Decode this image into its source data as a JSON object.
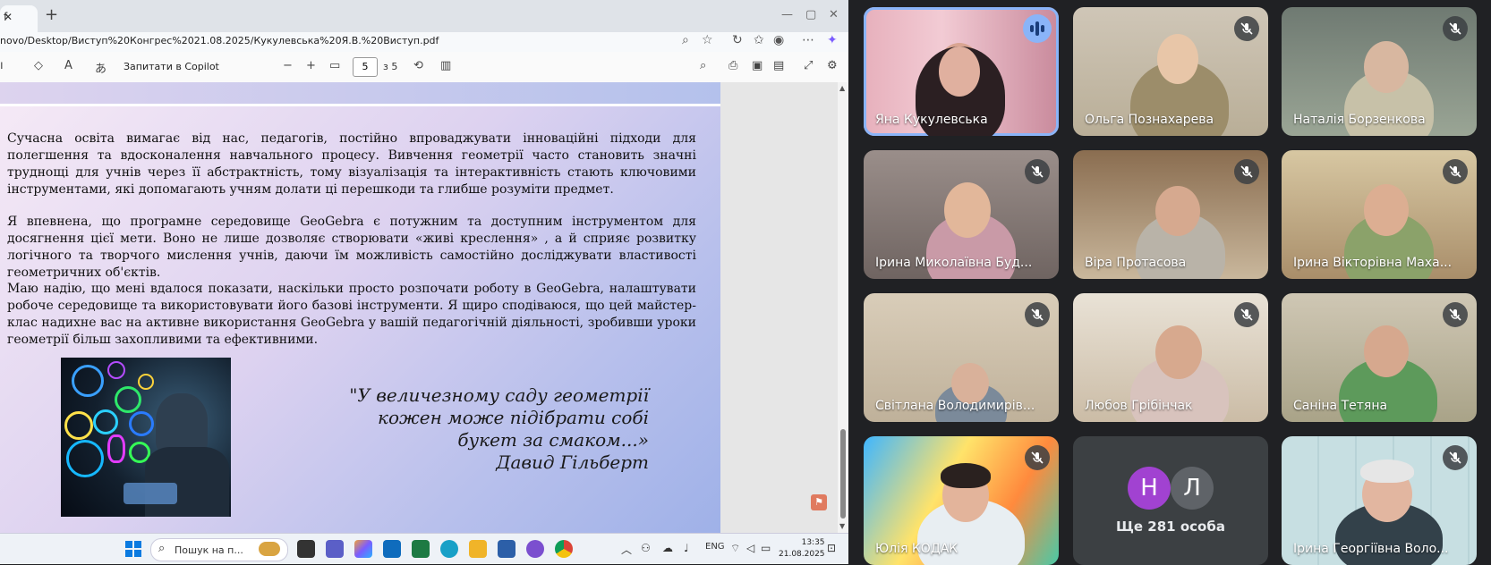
{
  "browser": {
    "tab_label": "f",
    "url": "novo/Desktop/Виступ%20Конгрес%2021.08.2025/Кукулевська%20Я.В.%20Виступ.pdf",
    "copilot_label": "Запитати в Copilot",
    "page_current": "5",
    "page_total": "з 5"
  },
  "document": {
    "paragraphs": [
      "Сучасна освіта вимагає від нас, педагогів, постійно впроваджувати інноваційні підходи для полегшення та вдосконалення навчального процесу. Вивчення геометрії часто становить значні труднощі для учнів через її абстрактність, тому візуалізація та інтерактивність стають ключовими інструментами, які допомагають учням долати ці перешкоди та глибше розуміти предмет.",
      "Я впевнена, що програмне середовище GeoGebra є потужним та доступним інструментом для досягнення цієї мети. Воно не лише дозволяє створювати «живі креслення» , а й сприяє розвитку логічного та творчого мислення учнів, даючи їм можливість самостійно досліджувати властивості геометричних об'єктів.",
      "Маю надію, що мені вдалося показати, наскільки просто розпочати роботу в GeoGebra, налаштувати робоче середовище та використовувати його базові інструменти. Я щиро сподіваюся, що цей майстер-клас надихне вас на активне використання GeoGebra у вашій педагогічній діяльності, зробивши уроки геометрії більш захопливими та ефективними."
    ],
    "quote_lines": [
      "\"У величезному саду геометрії",
      "кожен може підібрати собі",
      "букет за смаком...»",
      "Давид Гільберт"
    ]
  },
  "taskbar": {
    "search_placeholder": "Пошук на п...",
    "language": "ENG",
    "time": "13:35",
    "date": "21.08.2025"
  },
  "meeting": {
    "participants": [
      {
        "name": "Яна Кукулевська",
        "state": "speaking"
      },
      {
        "name": "Ольга Познахарева",
        "state": "muted"
      },
      {
        "name": "Наталія Борзенкова",
        "state": "muted"
      },
      {
        "name": "Ірина Миколаївна Буд...",
        "state": "muted"
      },
      {
        "name": "Віра Протасова",
        "state": "muted"
      },
      {
        "name": "Ірина Вікторівна Маха...",
        "state": "muted"
      },
      {
        "name": "Світлана Володимирів...",
        "state": "muted"
      },
      {
        "name": "Любов Грібінчак",
        "state": "muted"
      },
      {
        "name": "Саніна Тетяна",
        "state": "muted"
      },
      {
        "name": "Юлія КОДАК",
        "state": "muted"
      },
      {
        "name": "Ірина Георгіївна Воло...",
        "state": "muted"
      }
    ],
    "more": {
      "initials": [
        "Н",
        "Л"
      ],
      "label": "Ще 281 особа",
      "avatar_colors": [
        "#a142d1",
        "#5f6368"
      ]
    }
  }
}
